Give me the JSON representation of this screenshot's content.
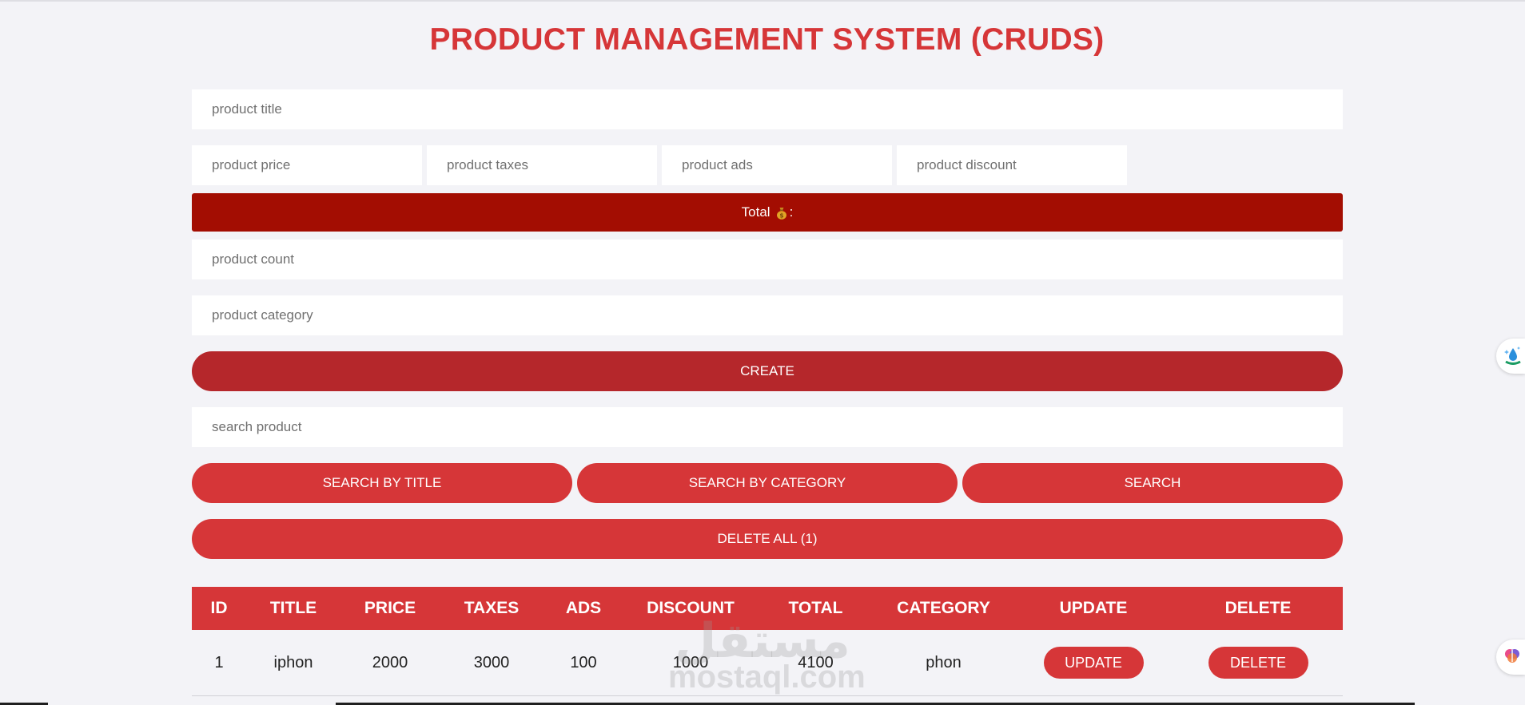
{
  "header": {
    "title": "PRODUCT MANAGEMENT SYSTEM (CRUDS)"
  },
  "form": {
    "title_placeholder": "product title",
    "price_placeholder": "product price",
    "taxes_placeholder": "product taxes",
    "ads_placeholder": "product ads",
    "discount_placeholder": "product discount",
    "total_label": "Total",
    "total_suffix": ":",
    "count_placeholder": "product count",
    "category_placeholder": "product category",
    "create_label": "CREATE"
  },
  "search": {
    "placeholder": "search product",
    "by_title_label": "SEARCH BY TITLE",
    "by_category_label": "SEARCH BY CATEGORY",
    "search_label": "SEARCH",
    "delete_all_label": "DELETE ALL (1)"
  },
  "table": {
    "headers": [
      "ID",
      "TITLE",
      "PRICE",
      "TAXES",
      "ADS",
      "DISCOUNT",
      "TOTAL",
      "CATEGORY",
      "UPDATE",
      "DELETE"
    ],
    "rows": [
      {
        "id": "1",
        "title": "iphon",
        "price": "2000",
        "taxes": "3000",
        "ads": "100",
        "discount": "1000",
        "total": "4100",
        "category": "phon",
        "update_label": "UPDATE",
        "delete_label": "DELETE"
      }
    ]
  },
  "watermark": {
    "arabic": "مستقل",
    "latin": "mostaql.com"
  },
  "colors": {
    "accent": "#d63638",
    "create": "#b5272b",
    "total_bar": "#a30d02",
    "background": "#f3f3f7"
  },
  "icons": {
    "total": "money-bag-icon"
  }
}
